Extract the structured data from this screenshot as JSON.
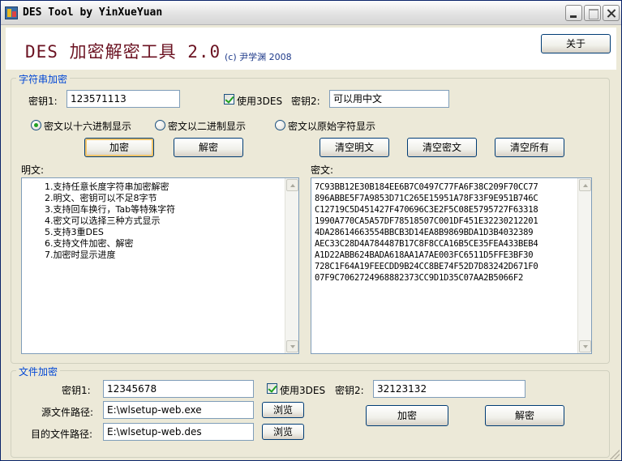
{
  "window": {
    "title": "DES Tool by YinXueYuan",
    "icon": "app-icon",
    "controls": {
      "minimize": "minimize-icon",
      "maximize": "maximize-icon",
      "close": "close-icon"
    }
  },
  "header": {
    "title": "DES 加密解密工具 2.0",
    "copyright": "(c) 尹学渊 2008",
    "about_label": "关于"
  },
  "string_group": {
    "title": "字符串加密",
    "key1_label": "密钥1:",
    "key1_value": "123571113",
    "use3des_label": "使用3DES",
    "use3des_checked": true,
    "key2_label": "密钥2:",
    "key2_value": "可以用中文",
    "display_modes": [
      {
        "label": "密文以十六进制显示",
        "checked": true
      },
      {
        "label": "密文以二进制显示",
        "checked": false
      },
      {
        "label": "密文以原始字符显示",
        "checked": false
      }
    ],
    "encrypt_label": "加密",
    "decrypt_label": "解密",
    "clear_plain_label": "清空明文",
    "clear_cipher_label": "清空密文",
    "clear_all_label": "清空所有",
    "plaintext_label": "明文:",
    "ciphertext_label": "密文:",
    "plaintext_lines": [
      "1.支持任意长度字符串加密解密",
      "2.明文、密钥可以不足8字节",
      "3.支持回车换行，Tab等特殊字符",
      "4.密文可以选择三种方式显示",
      "5.支持3重DES",
      "6.支持文件加密、解密",
      "7.加密时显示进度"
    ],
    "ciphertext_lines": [
      "7C93BB12E30B184EE6B7C0497C77FA6F38C209F70CC77",
      "896ABBE5F7A9853D71C265E15951A78F33F9E951B746C",
      "C12719C5D451427F470696C3E2F5C08E5795727F63318",
      "1990A770CA5A57DF78518507C001DF451E32230212201",
      "4DA28614663554BBCB3D14EA8B9869BDA1D3B4032389",
      "AEC33C28D4A784487B17C8F8CCA16B5CE35FEA433BEB4",
      "A1D22ABB624BADA618AA1A7AE003FC6511D5FFE3BF30",
      "728C1F64A19FEECDD9B24CC8BE74F52D7D83242D671F0",
      "07F9C7062724968882373CC9D1D35C07AA2B5066F2"
    ]
  },
  "file_group": {
    "title": "文件加密",
    "key1_label": "密钥1:",
    "key1_value": "12345678",
    "use3des_label": "使用3DES",
    "use3des_checked": true,
    "key2_label": "密钥2:",
    "key2_value": "32123132",
    "source_label": "源文件路径:",
    "source_value": "E:\\wlsetup-web.exe",
    "dest_label": "目的文件路径:",
    "dest_value": "E:\\wlsetup-web.des",
    "browse_label": "浏览",
    "encrypt_label": "加密",
    "decrypt_label": "解密"
  },
  "colors": {
    "heading": "#6b1221",
    "group_title": "#0046d5",
    "check_mark": "#21a121",
    "window_bg": "#ece9d8"
  }
}
